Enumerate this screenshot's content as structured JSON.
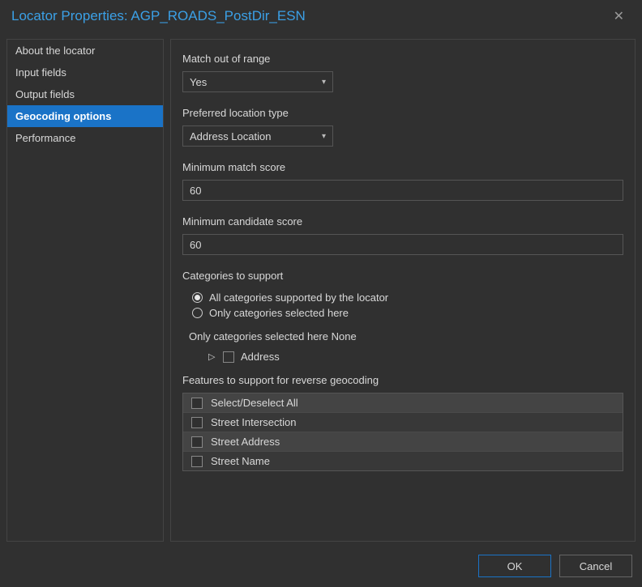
{
  "titlebar": {
    "title": "Locator Properties: AGP_ROADS_PostDir_ESN"
  },
  "sidebar": {
    "items": [
      {
        "label": "About the locator",
        "selected": false
      },
      {
        "label": "Input fields",
        "selected": false
      },
      {
        "label": "Output fields",
        "selected": false
      },
      {
        "label": "Geocoding options",
        "selected": true
      },
      {
        "label": "Performance",
        "selected": false
      }
    ]
  },
  "form": {
    "match_out_of_range": {
      "label": "Match out of range",
      "value": "Yes"
    },
    "preferred_location_type": {
      "label": "Preferred location type",
      "value": "Address Location"
    },
    "min_match_score": {
      "label": "Minimum match score",
      "value": "60"
    },
    "min_candidate_score": {
      "label": "Minimum candidate score",
      "value": "60"
    },
    "categories": {
      "label": "Categories to support",
      "options": [
        {
          "label": "All categories supported by the locator",
          "checked": true
        },
        {
          "label": "Only categories selected here",
          "checked": false
        }
      ],
      "sub_label": "Only categories selected here None",
      "tree_item": "Address"
    },
    "reverse_features": {
      "label": "Features to support for reverse geocoding",
      "items": [
        {
          "label": "Select/Deselect All",
          "checked": false
        },
        {
          "label": "Street Intersection",
          "checked": false
        },
        {
          "label": "Street Address",
          "checked": false
        },
        {
          "label": "Street Name",
          "checked": false
        }
      ]
    }
  },
  "footer": {
    "ok": "OK",
    "cancel": "Cancel"
  }
}
